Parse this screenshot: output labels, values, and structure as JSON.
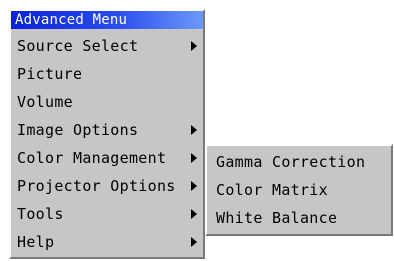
{
  "menu": {
    "title": "Advanced Menu",
    "items": [
      {
        "label": "Source Select",
        "has_submenu": true
      },
      {
        "label": "Picture",
        "has_submenu": false
      },
      {
        "label": "Volume",
        "has_submenu": false
      },
      {
        "label": "Image Options",
        "has_submenu": true
      },
      {
        "label": "Color Management",
        "has_submenu": true
      },
      {
        "label": "Projector Options",
        "has_submenu": true
      },
      {
        "label": "Tools",
        "has_submenu": true
      },
      {
        "label": "Help",
        "has_submenu": true
      }
    ]
  },
  "submenu": {
    "parent": "Color Management",
    "items": [
      {
        "label": "Gamma Correction"
      },
      {
        "label": "Color Matrix"
      },
      {
        "label": "White Balance"
      }
    ]
  },
  "colors": {
    "menu_bg": "#c6c6c6",
    "title_bg": "#0a22d6",
    "title_text": "#ffffff",
    "text": "#000000"
  },
  "icons": {
    "submenu_arrow": "right-triangle"
  }
}
